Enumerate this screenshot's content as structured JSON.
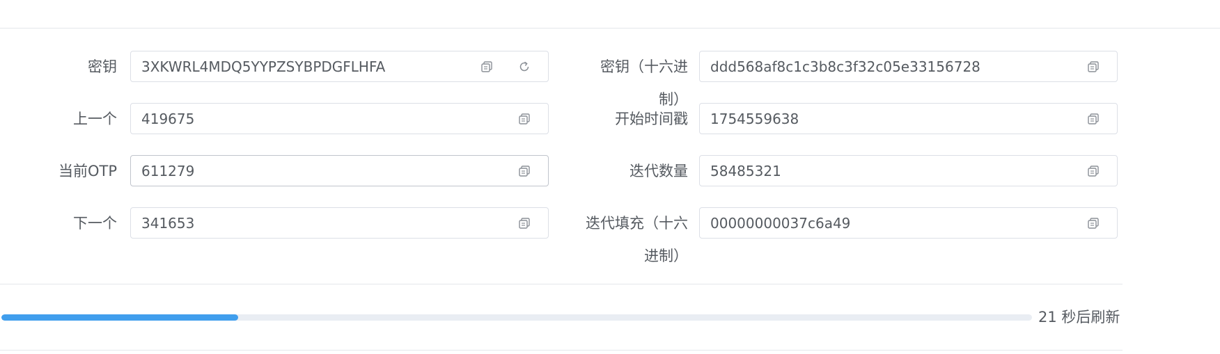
{
  "fields": {
    "secret": {
      "label": "密钥",
      "value": "3XKWRL4MDQ5YYPZSYBPDGFLHFA"
    },
    "secret_hex": {
      "label": "密钥（十六进制）",
      "value": "ddd568af8c1c3b8c3f32c05e33156728"
    },
    "previous": {
      "label": "上一个",
      "value": "419675"
    },
    "start_timestamp": {
      "label": "开始时间戳",
      "value": "1754559638"
    },
    "current_otp": {
      "label": "当前OTP",
      "value": "611279"
    },
    "iterations": {
      "label": "迭代数量",
      "value": "58485321"
    },
    "next": {
      "label": "下一个",
      "value": "341653"
    },
    "iteration_padding_hex": {
      "label": "迭代填充（十六进制）",
      "value": "00000000037c6a49"
    }
  },
  "countdown": {
    "seconds_remaining": 21,
    "text": "21 秒后刷新",
    "progress_fraction": 0.23
  },
  "icons": {
    "copy": "copy-icon",
    "refresh": "refresh-icon"
  },
  "colors": {
    "progress_fill": "#409eed",
    "progress_track": "#e9edf3",
    "border": "#dcdfe6"
  }
}
